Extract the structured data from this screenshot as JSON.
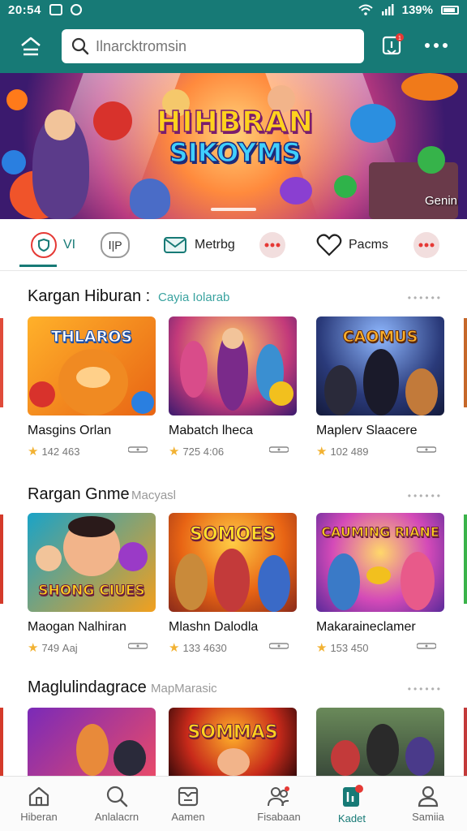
{
  "status_bar": {
    "time": "20:54",
    "battery": "139%"
  },
  "header": {
    "search_placeholder": "Ilnarcktromsin"
  },
  "banner": {
    "title_line1": "HIHBRAN",
    "title_line2": "SIKOYMS",
    "caption": "Genin"
  },
  "tabs": [
    {
      "label": "VI",
      "icon": "shield-icon"
    },
    {
      "label": "",
      "icon": "pill-icon"
    },
    {
      "label": "Metrbg",
      "icon": "envelope-icon"
    },
    {
      "label": "",
      "icon": "dots-badge-icon"
    },
    {
      "label": "Pacms",
      "icon": "heart-icon"
    },
    {
      "label": "",
      "icon": "dots-badge-icon"
    }
  ],
  "sections": [
    {
      "title": "Kargan Hiburan :",
      "subtitle": "Cayia Iolarab",
      "items": [
        {
          "name": "Masgins Orlan",
          "stat": "142 463",
          "thumb_text": "THLAROS"
        },
        {
          "name": "Mabatch lheca",
          "stat": "725 4:06",
          "thumb_text": ""
        },
        {
          "name": "Maplerv Slaacere",
          "stat": "102 489",
          "thumb_text": "CAOMUS"
        }
      ]
    },
    {
      "title": "Rargan Gnme",
      "subtitle": "Macyasl",
      "items": [
        {
          "name": "Maogan Nalhiran",
          "stat": "749 Ааj",
          "thumb_text": "SHONG CIUES"
        },
        {
          "name": "Mlashn Dalodla",
          "stat": "133 4630",
          "thumb_text": "SOMOES"
        },
        {
          "name": "Makaraineclamer",
          "stat": "153 450",
          "thumb_text": "CAUMING RIANE"
        }
      ]
    },
    {
      "title": "Maglulindagrace",
      "subtitle": "MapMarasic",
      "items": [
        {
          "name": "",
          "stat": "",
          "thumb_text": ""
        },
        {
          "name": "",
          "stat": "",
          "thumb_text": "SOMMAS"
        },
        {
          "name": "",
          "stat": "",
          "thumb_text": ""
        }
      ]
    }
  ],
  "bottom_nav": [
    {
      "label": "Hiberan",
      "icon": "home-icon"
    },
    {
      "label": "Anlalacrn",
      "icon": "search-icon"
    },
    {
      "label": "Aamen",
      "icon": "inbox-icon"
    },
    {
      "label": "Fisabaan",
      "icon": "people-icon"
    },
    {
      "label": "Kadet",
      "icon": "bookmark-icon",
      "active": true,
      "badge": "1"
    },
    {
      "label": "Samiia",
      "icon": "user-icon"
    }
  ],
  "colors": {
    "primary": "#177a76",
    "accent": "#e53935",
    "star": "#f2b233"
  }
}
